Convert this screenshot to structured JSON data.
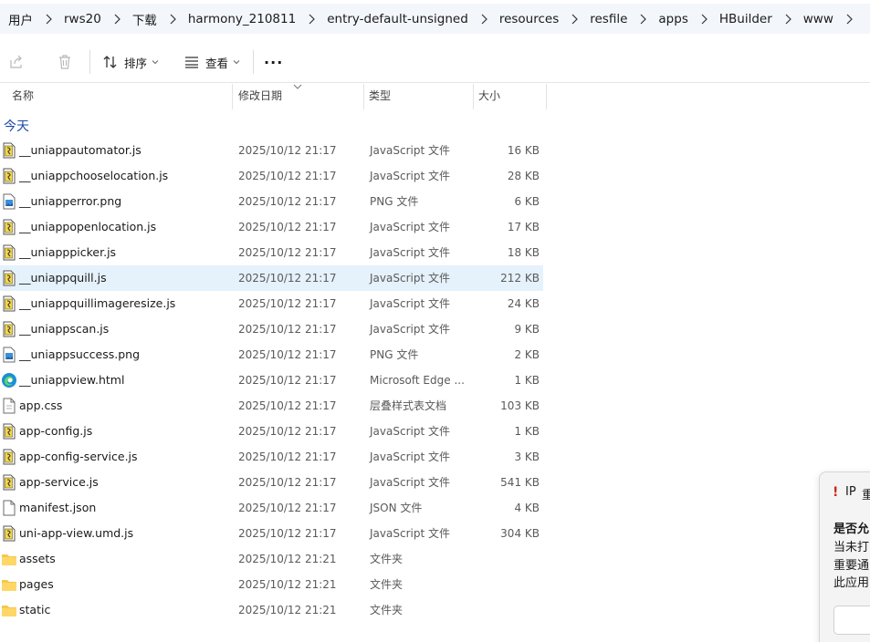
{
  "breadcrumb": [
    "用户",
    "rws20",
    "下载",
    "harmony_210811",
    "entry-default-unsigned",
    "resources",
    "resfile",
    "apps",
    "HBuilder",
    "www"
  ],
  "toolbar": {
    "sort_label": "排序",
    "view_label": "查看",
    "more_label": "···"
  },
  "columns": {
    "name": "名称",
    "date": "修改日期",
    "type": "类型",
    "size": "大小"
  },
  "group_label": "今天",
  "files": [
    {
      "name": "__uniappautomator.js",
      "date": "2025/10/12 21:17",
      "type": "JavaScript 文件",
      "size": "16 KB",
      "icon": "js-file-icon"
    },
    {
      "name": "__uniappchooselocation.js",
      "date": "2025/10/12 21:17",
      "type": "JavaScript 文件",
      "size": "28 KB",
      "icon": "js-file-icon"
    },
    {
      "name": "__uniapperror.png",
      "date": "2025/10/12 21:17",
      "type": "PNG 文件",
      "size": "6 KB",
      "icon": "image-file-icon"
    },
    {
      "name": "__uniappopenlocation.js",
      "date": "2025/10/12 21:17",
      "type": "JavaScript 文件",
      "size": "17 KB",
      "icon": "js-file-icon"
    },
    {
      "name": "__uniapppicker.js",
      "date": "2025/10/12 21:17",
      "type": "JavaScript 文件",
      "size": "18 KB",
      "icon": "js-file-icon"
    },
    {
      "name": "__uniappquill.js",
      "date": "2025/10/12 21:17",
      "type": "JavaScript 文件",
      "size": "212 KB",
      "icon": "js-file-icon",
      "selected": true
    },
    {
      "name": "__uniappquillimageresize.js",
      "date": "2025/10/12 21:17",
      "type": "JavaScript 文件",
      "size": "24 KB",
      "icon": "js-file-icon"
    },
    {
      "name": "__uniappscan.js",
      "date": "2025/10/12 21:17",
      "type": "JavaScript 文件",
      "size": "9 KB",
      "icon": "js-file-icon"
    },
    {
      "name": "__uniappsuccess.png",
      "date": "2025/10/12 21:17",
      "type": "PNG 文件",
      "size": "2 KB",
      "icon": "image-file-icon"
    },
    {
      "name": "__uniappview.html",
      "date": "2025/10/12 21:17",
      "type": "Microsoft Edge ...",
      "size": "1 KB",
      "icon": "edge-icon"
    },
    {
      "name": "app.css",
      "date": "2025/10/12 21:17",
      "type": "层叠样式表文档",
      "size": "103 KB",
      "icon": "css-file-icon"
    },
    {
      "name": "app-config.js",
      "date": "2025/10/12 21:17",
      "type": "JavaScript 文件",
      "size": "1 KB",
      "icon": "js-file-icon"
    },
    {
      "name": "app-config-service.js",
      "date": "2025/10/12 21:17",
      "type": "JavaScript 文件",
      "size": "3 KB",
      "icon": "js-file-icon"
    },
    {
      "name": "app-service.js",
      "date": "2025/10/12 21:17",
      "type": "JavaScript 文件",
      "size": "541 KB",
      "icon": "js-file-icon"
    },
    {
      "name": "manifest.json",
      "date": "2025/10/12 21:17",
      "type": "JSON 文件",
      "size": "4 KB",
      "icon": "json-file-icon"
    },
    {
      "name": "uni-app-view.umd.js",
      "date": "2025/10/12 21:17",
      "type": "JavaScript 文件",
      "size": "304 KB",
      "icon": "js-file-icon"
    },
    {
      "name": "assets",
      "date": "2025/10/12 21:21",
      "type": "文件夹",
      "size": "",
      "icon": "folder-icon"
    },
    {
      "name": "pages",
      "date": "2025/10/12 21:21",
      "type": "文件夹",
      "size": "",
      "icon": "folder-icon"
    },
    {
      "name": "static",
      "date": "2025/10/12 21:21",
      "type": "文件夹",
      "size": "",
      "icon": "folder-icon"
    }
  ],
  "dialog": {
    "title_part1": "IP",
    "title_part2": "重",
    "heading": "是否允",
    "lines": [
      "当未打",
      "重要通",
      "此应用"
    ]
  },
  "colors": {
    "selection": "#e5f1fb",
    "group_label": "#1b4aa6",
    "breadcrumb_bg": "#f3f6fb"
  }
}
